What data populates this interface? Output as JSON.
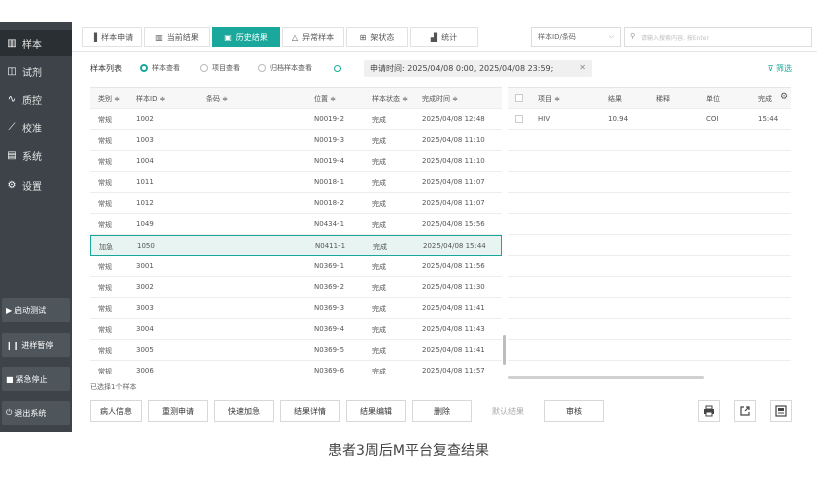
{
  "sidebar": {
    "items": [
      {
        "icon": "grid-icon",
        "glyph": "▥",
        "label": "样本"
      },
      {
        "icon": "reagent-icon",
        "glyph": "◫",
        "label": "试剂"
      },
      {
        "icon": "qc-icon",
        "glyph": "∿",
        "label": "质控"
      },
      {
        "icon": "calibration-icon",
        "glyph": "⟋",
        "label": "校准"
      },
      {
        "icon": "system-icon",
        "glyph": "▤",
        "label": "系统"
      },
      {
        "icon": "settings-icon",
        "glyph": "⚙",
        "label": "设置"
      }
    ],
    "actions": [
      {
        "glyph": "▶",
        "label": "启动测试"
      },
      {
        "glyph": "❙❙",
        "label": "进样暂停"
      },
      {
        "glyph": "■",
        "label": "紧急停止"
      },
      {
        "glyph": "⏻",
        "label": "退出系统"
      }
    ]
  },
  "tabs": [
    {
      "glyph": "▐",
      "label": "样本申请"
    },
    {
      "glyph": "▥",
      "label": "当前结果"
    },
    {
      "glyph": "▣",
      "label": "历史结果"
    },
    {
      "glyph": "△",
      "label": "异常样本"
    },
    {
      "glyph": "⊞",
      "label": "架状态"
    },
    {
      "glyph": "▟",
      "label": "统计"
    }
  ],
  "search": {
    "select_value": "样本ID/条码",
    "placeholder": "请输入搜索内容, 按Enter"
  },
  "filter": {
    "title": "样本列表",
    "options": [
      "样本查看",
      "项目查看",
      "归档样本查看"
    ],
    "date_range": "申请时间: 2025/04/08 0:00, 2025/04/08 23:59;",
    "filter_label": "筛选"
  },
  "sample_table": {
    "headers": [
      "类别 ≑",
      "样本ID ≑",
      "条码 ≑",
      "位置 ≑",
      "样本状态 ≑",
      "完成时间 ≑"
    ],
    "rows": [
      [
        "常规",
        "1002",
        "",
        "N0019-2",
        "完成",
        "2025/04/08 12:48"
      ],
      [
        "常规",
        "1003",
        "",
        "N0019-3",
        "完成",
        "2025/04/08 11:10"
      ],
      [
        "常规",
        "1004",
        "",
        "N0019-4",
        "完成",
        "2025/04/08 11:10"
      ],
      [
        "常规",
        "1011",
        "",
        "N0018-1",
        "完成",
        "2025/04/08 11:07"
      ],
      [
        "常规",
        "1012",
        "",
        "N0018-2",
        "完成",
        "2025/04/08 11:07"
      ],
      [
        "常规",
        "1049",
        "",
        "N0434-1",
        "完成",
        "2025/04/08 15:56"
      ],
      [
        "加急",
        "1050",
        "",
        "N0411-1",
        "完成",
        "2025/04/08 15:44"
      ],
      [
        "常规",
        "3001",
        "",
        "N0369-1",
        "完成",
        "2025/04/08 11:56"
      ],
      [
        "常规",
        "3002",
        "",
        "N0369-2",
        "完成",
        "2025/04/08 11:30"
      ],
      [
        "常规",
        "3003",
        "",
        "N0369-3",
        "完成",
        "2025/04/08 11:41"
      ],
      [
        "常规",
        "3004",
        "",
        "N0369-4",
        "完成",
        "2025/04/08 11:43"
      ],
      [
        "常规",
        "3005",
        "",
        "N0369-5",
        "完成",
        "2025/04/08 11:41"
      ],
      [
        "常规",
        "3006",
        "",
        "N0369-6",
        "完成",
        "2025/04/08 11:57"
      ]
    ],
    "selected_index": 6
  },
  "result_table": {
    "headers": [
      "项目 ≑",
      "结果",
      "稀释",
      "单位",
      "完成"
    ],
    "rows": [
      [
        "HIV",
        "10.94",
        "",
        "COI",
        "15:44"
      ]
    ]
  },
  "selected_count": "已选择1个样本",
  "buttons": [
    "病人信息",
    "重测申请",
    "快速加急",
    "结果详情",
    "结果编辑",
    "删除",
    "默认结果",
    "审核"
  ],
  "caption": "患者3周后M平台复查结果",
  "colors": {
    "accent": "#1aa89c",
    "sidebar": "#3d4348"
  }
}
